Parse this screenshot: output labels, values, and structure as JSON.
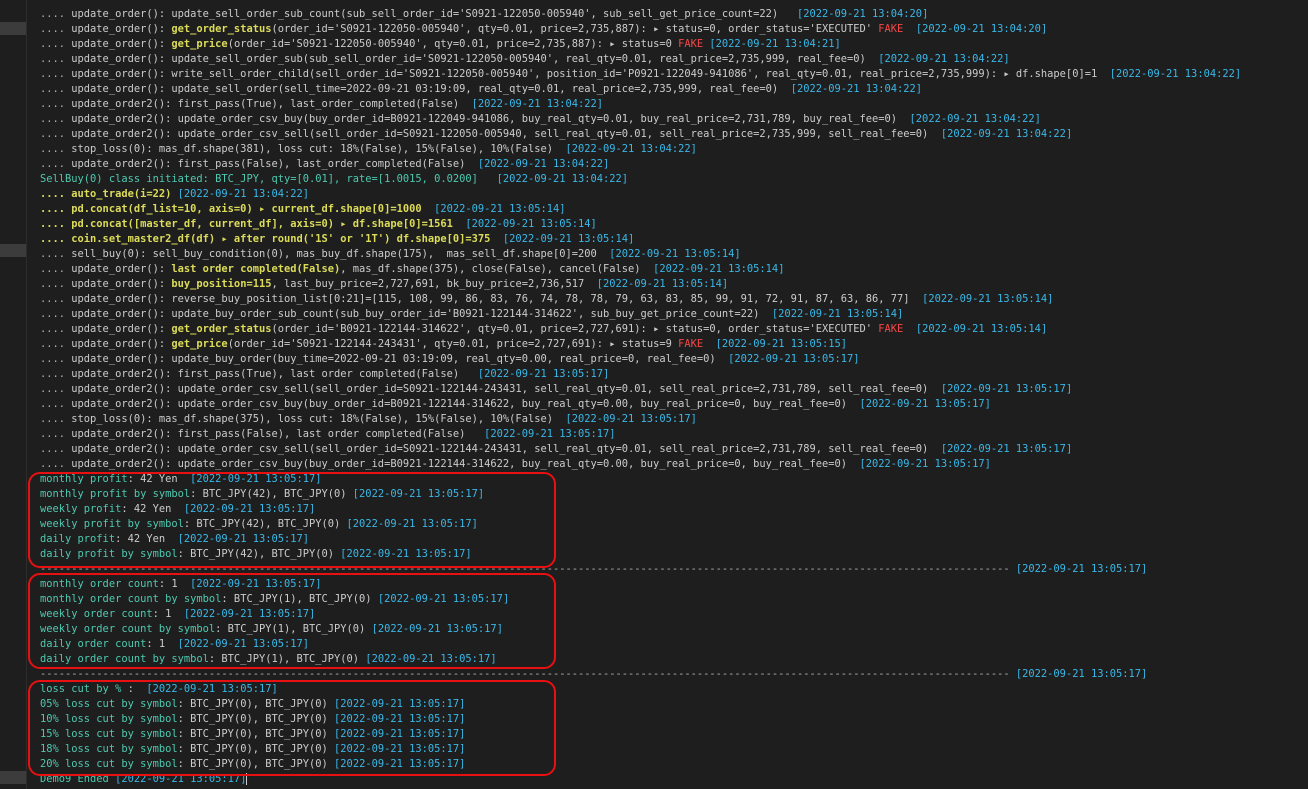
{
  "colors": {
    "background": "#1e1e1e",
    "timestamp": "#3ab8e8",
    "highlight": "#dcdc5a",
    "fake": "#f44747",
    "stat": "#4ec9b0",
    "box": "#e81010"
  },
  "lines": [
    [
      {
        "t": ".... ",
        "c": "d"
      },
      {
        "t": "update_order(): update_sell_order_sub_count(sub_sell_order_id='S0921-122050-005940', sub_sell_get_price_count=22)   ",
        "c": "w"
      },
      {
        "t": "[2022-09-21 13:04:20]",
        "c": "c"
      }
    ],
    [
      {
        "t": ".... ",
        "c": "d"
      },
      {
        "t": "update_order(): ",
        "c": "w"
      },
      {
        "t": "get_order_status",
        "c": "y"
      },
      {
        "t": "(order_id='S0921-122050-005940', qty=0.01, price=2,735,887): ▸ status=0, order_status='EXECUTED' ",
        "c": "w"
      },
      {
        "t": "FAKE",
        "c": "r"
      },
      {
        "t": "  ",
        "c": "w"
      },
      {
        "t": "[2022-09-21 13:04:20]",
        "c": "c"
      }
    ],
    [
      {
        "t": ".... ",
        "c": "d"
      },
      {
        "t": "update_order(): ",
        "c": "w"
      },
      {
        "t": "get_price",
        "c": "y"
      },
      {
        "t": "(order_id='S0921-122050-005940', qty=0.01, price=2,735,887): ▸ status=0 ",
        "c": "w"
      },
      {
        "t": "FAKE",
        "c": "r"
      },
      {
        "t": " ",
        "c": "w"
      },
      {
        "t": "[2022-09-21 13:04:21]",
        "c": "c"
      }
    ],
    [
      {
        "t": ".... ",
        "c": "d"
      },
      {
        "t": "update_order(): update_sell_order_sub(sub_sell_order_id='S0921-122050-005940', real_qty=0.01, real_price=2,735,999, real_fee=0)  ",
        "c": "w"
      },
      {
        "t": "[2022-09-21 13:04:22]",
        "c": "c"
      }
    ],
    [
      {
        "t": ".... ",
        "c": "d"
      },
      {
        "t": "update_order(): write_sell_order_child(sell_order_id='S0921-122050-005940', position_id='P0921-122049-941086', real_qty=0.01, real_price=2,735,999): ▸ df.shape[0]=1  ",
        "c": "w"
      },
      {
        "t": "[2022-09-21 13:04:22]",
        "c": "c"
      }
    ],
    [
      {
        "t": ".... ",
        "c": "d"
      },
      {
        "t": "update_order(): update_sell_order(sell_time=2022-09-21 03:19:09, real_qty=0.01, real_price=2,735,999, real_fee=0)  ",
        "c": "w"
      },
      {
        "t": "[2022-09-21 13:04:22]",
        "c": "c"
      }
    ],
    [
      {
        "t": ".... ",
        "c": "d"
      },
      {
        "t": "update_order2(): first_pass(True), last_order_completed(False)  ",
        "c": "w"
      },
      {
        "t": "[2022-09-21 13:04:22]",
        "c": "c"
      }
    ],
    [
      {
        "t": ".... ",
        "c": "d"
      },
      {
        "t": "update_order2(): update_order_csv_buy(buy_order_id=B0921-122049-941086, buy_real_qty=0.01, buy_real_price=2,731,789, buy_real_fee=0)  ",
        "c": "w"
      },
      {
        "t": "[2022-09-21 13:04:22]",
        "c": "c"
      }
    ],
    [
      {
        "t": ".... ",
        "c": "d"
      },
      {
        "t": "update_order2(): update_order_csv_sell(sell_order_id=S0921-122050-005940, sell_real_qty=0.01, sell_real_price=2,735,999, sell_real_fee=0)  ",
        "c": "w"
      },
      {
        "t": "[2022-09-21 13:04:22]",
        "c": "c"
      }
    ],
    [
      {
        "t": ".... ",
        "c": "d"
      },
      {
        "t": "stop_loss(0): mas_df.shape(381), loss cut: 18%(False), 15%(False), 10%(False)  ",
        "c": "w"
      },
      {
        "t": "[2022-09-21 13:04:22]",
        "c": "c"
      }
    ],
    [
      {
        "t": ".... ",
        "c": "d"
      },
      {
        "t": "update_order2(): first_pass(False), last_order_completed(False)  ",
        "c": "w"
      },
      {
        "t": "[2022-09-21 13:04:22]",
        "c": "c"
      }
    ],
    [
      {
        "t": "SellBuy(0) class initiated: BTC_JPY, qty=[0.01], rate=[1.0015, 0.0200]   ",
        "c": "g"
      },
      {
        "t": "[2022-09-21 13:04:22]",
        "c": "c"
      }
    ],
    [
      {
        "t": ".... auto_trade(i=22) ",
        "c": "y"
      },
      {
        "t": "[2022-09-21 13:04:22]",
        "c": "c"
      }
    ],
    [
      {
        "t": ".... pd.concat(df_list=10, axis=0) ▸ current_df.shape[0]=1000  ",
        "c": "y"
      },
      {
        "t": "[2022-09-21 13:05:14]",
        "c": "c"
      }
    ],
    [
      {
        "t": ".... pd.concat([master_df, current_df], axis=0) ▸ df.shape[0]=1561  ",
        "c": "y"
      },
      {
        "t": "[2022-09-21 13:05:14]",
        "c": "c"
      }
    ],
    [
      {
        "t": ".... coin.set_master2_df(df) ▸ after round('1S' or '1T') df.shape[0]=375  ",
        "c": "y"
      },
      {
        "t": "[2022-09-21 13:05:14]",
        "c": "c"
      }
    ],
    [
      {
        "t": ".... ",
        "c": "d"
      },
      {
        "t": "sell_buy(0): sell_buy_condition(0), mas_buy_df.shape(175),  mas_sell_df.shape[0]=200  ",
        "c": "w"
      },
      {
        "t": "[2022-09-21 13:05:14]",
        "c": "c"
      }
    ],
    [
      {
        "t": ".... ",
        "c": "d"
      },
      {
        "t": "update_order(): ",
        "c": "w"
      },
      {
        "t": "last order completed(False)",
        "c": "y"
      },
      {
        "t": ", mas_df.shape(375), close(False), cancel(False)  ",
        "c": "w"
      },
      {
        "t": "[2022-09-21 13:05:14]",
        "c": "c"
      }
    ],
    [
      {
        "t": ".... ",
        "c": "d"
      },
      {
        "t": "update_order(): ",
        "c": "w"
      },
      {
        "t": "buy_position=115",
        "c": "y"
      },
      {
        "t": ", last_buy_price=2,727,691, bk_buy_price=2,736,517  ",
        "c": "w"
      },
      {
        "t": "[2022-09-21 13:05:14]",
        "c": "c"
      }
    ],
    [
      {
        "t": ".... ",
        "c": "d"
      },
      {
        "t": "update_order(): reverse_buy_position_list[0:21]=[115, 108, 99, 86, 83, 76, 74, 78, 78, 79, 63, 83, 85, 99, 91, 72, 91, 87, 63, 86, 77]  ",
        "c": "w"
      },
      {
        "t": "[2022-09-21 13:05:14]",
        "c": "c"
      }
    ],
    [
      {
        "t": ".... ",
        "c": "d"
      },
      {
        "t": "update_order(): update_buy_order_sub_count(sub_buy_order_id='B0921-122144-314622', sub_buy_get_price_count=22)  ",
        "c": "w"
      },
      {
        "t": "[2022-09-21 13:05:14]",
        "c": "c"
      }
    ],
    [
      {
        "t": ".... ",
        "c": "d"
      },
      {
        "t": "update_order(): ",
        "c": "w"
      },
      {
        "t": "get_order_status",
        "c": "y"
      },
      {
        "t": "(order_id='B0921-122144-314622', qty=0.01, price=2,727,691): ▸ status=0, order_status='EXECUTED' ",
        "c": "w"
      },
      {
        "t": "FAKE",
        "c": "r"
      },
      {
        "t": "  ",
        "c": "w"
      },
      {
        "t": "[2022-09-21 13:05:14]",
        "c": "c"
      }
    ],
    [
      {
        "t": ".... ",
        "c": "d"
      },
      {
        "t": "update_order(): ",
        "c": "w"
      },
      {
        "t": "get_price",
        "c": "y"
      },
      {
        "t": "(order_id='S0921-122144-243431', qty=0.01, price=2,727,691): ▸ status=9 ",
        "c": "w"
      },
      {
        "t": "FAKE",
        "c": "r"
      },
      {
        "t": "  ",
        "c": "w"
      },
      {
        "t": "[2022-09-21 13:05:15]",
        "c": "c"
      }
    ],
    [
      {
        "t": ".... ",
        "c": "d"
      },
      {
        "t": "update_order(): update_buy_order(buy_time=2022-09-21 03:19:09, real_qty=0.00, real_price=0, real_fee=0)  ",
        "c": "w"
      },
      {
        "t": "[2022-09-21 13:05:17]",
        "c": "c"
      }
    ],
    [
      {
        "t": ".... ",
        "c": "d"
      },
      {
        "t": "update_order2(): first_pass(True), last order completed(False)   ",
        "c": "w"
      },
      {
        "t": "[2022-09-21 13:05:17]",
        "c": "c"
      }
    ],
    [
      {
        "t": ".... ",
        "c": "d"
      },
      {
        "t": "update_order2(): update_order_csv_sell(sell_order_id=S0921-122144-243431, sell_real_qty=0.01, sell_real_price=2,731,789, sell_real_fee=0)  ",
        "c": "w"
      },
      {
        "t": "[2022-09-21 13:05:17]",
        "c": "c"
      }
    ],
    [
      {
        "t": ".... ",
        "c": "d"
      },
      {
        "t": "update_order2(): update_order_csv_buy(buy_order_id=B0921-122144-314622, buy_real_qty=0.00, buy_real_price=0, buy_real_fee=0)  ",
        "c": "w"
      },
      {
        "t": "[2022-09-21 13:05:17]",
        "c": "c"
      }
    ],
    [
      {
        "t": ".... ",
        "c": "d"
      },
      {
        "t": "stop_loss(0): mas_df.shape(375), loss cut: 18%(False), 15%(False), 10%(False)  ",
        "c": "w"
      },
      {
        "t": "[2022-09-21 13:05:17]",
        "c": "c"
      }
    ],
    [
      {
        "t": ".... ",
        "c": "d"
      },
      {
        "t": "update_order2(): first_pass(False), last order completed(False)   ",
        "c": "w"
      },
      {
        "t": "[2022-09-21 13:05:17]",
        "c": "c"
      }
    ],
    [
      {
        "t": ".... ",
        "c": "d"
      },
      {
        "t": "update_order2(): update_order_csv_sell(sell_order_id=S0921-122144-243431, sell_real_qty=0.01, sell_real_price=2,731,789, sell_real_fee=0)  ",
        "c": "w"
      },
      {
        "t": "[2022-09-21 13:05:17]",
        "c": "c"
      }
    ],
    [
      {
        "t": ".... ",
        "c": "d"
      },
      {
        "t": "update_order2(): update_order_csv_buy(buy_order_id=B0921-122144-314622, buy_real_qty=0.00, buy_real_price=0, buy_real_fee=0)  ",
        "c": "w"
      },
      {
        "t": "[2022-09-21 13:05:17]",
        "c": "c"
      }
    ],
    [
      {
        "t": "monthly profit",
        "c": "g"
      },
      {
        "t": ": 42 Yen  ",
        "c": "w"
      },
      {
        "t": "[2022-09-21 13:05:17]",
        "c": "c"
      }
    ],
    [
      {
        "t": "monthly profit by symbol",
        "c": "g"
      },
      {
        "t": ": BTC_JPY(42), BTC_JPY(0) ",
        "c": "w"
      },
      {
        "t": "[2022-09-21 13:05:17]",
        "c": "c"
      }
    ],
    [
      {
        "t": "weekly profit",
        "c": "g"
      },
      {
        "t": ": 42 Yen  ",
        "c": "w"
      },
      {
        "t": "[2022-09-21 13:05:17]",
        "c": "c"
      }
    ],
    [
      {
        "t": "weekly profit by symbol",
        "c": "g"
      },
      {
        "t": ": BTC_JPY(42), BTC_JPY(0) ",
        "c": "w"
      },
      {
        "t": "[2022-09-21 13:05:17]",
        "c": "c"
      }
    ],
    [
      {
        "t": "daily profit",
        "c": "g"
      },
      {
        "t": ": 42 Yen  ",
        "c": "w"
      },
      {
        "t": "[2022-09-21 13:05:17]",
        "c": "c"
      }
    ],
    [
      {
        "t": "daily profit by symbol",
        "c": "g"
      },
      {
        "t": ": BTC_JPY(42), BTC_JPY(0) ",
        "c": "w"
      },
      {
        "t": "[2022-09-21 13:05:17]",
        "c": "c"
      }
    ],
    [
      {
        "t": "----------------------------------------------------------------------------------------------------------------------------------------------------------- ",
        "c": "d"
      },
      {
        "t": "[2022-09-21 13:05:17]",
        "c": "c"
      }
    ],
    [
      {
        "t": "monthly order count",
        "c": "g"
      },
      {
        "t": ": 1  ",
        "c": "w"
      },
      {
        "t": "[2022-09-21 13:05:17]",
        "c": "c"
      }
    ],
    [
      {
        "t": "monthly order count by symbol",
        "c": "g"
      },
      {
        "t": ": BTC_JPY(1), BTC_JPY(0) ",
        "c": "w"
      },
      {
        "t": "[2022-09-21 13:05:17]",
        "c": "c"
      }
    ],
    [
      {
        "t": "weekly order count",
        "c": "g"
      },
      {
        "t": ": 1  ",
        "c": "w"
      },
      {
        "t": "[2022-09-21 13:05:17]",
        "c": "c"
      }
    ],
    [
      {
        "t": "weekly order count by symbol",
        "c": "g"
      },
      {
        "t": ": BTC_JPY(1), BTC_JPY(0) ",
        "c": "w"
      },
      {
        "t": "[2022-09-21 13:05:17]",
        "c": "c"
      }
    ],
    [
      {
        "t": "daily order count",
        "c": "g"
      },
      {
        "t": ": 1  ",
        "c": "w"
      },
      {
        "t": "[2022-09-21 13:05:17]",
        "c": "c"
      }
    ],
    [
      {
        "t": "daily order count by symbol",
        "c": "g"
      },
      {
        "t": ": BTC_JPY(1), BTC_JPY(0) ",
        "c": "w"
      },
      {
        "t": "[2022-09-21 13:05:17]",
        "c": "c"
      }
    ],
    [
      {
        "t": "----------------------------------------------------------------------------------------------------------------------------------------------------------- ",
        "c": "d"
      },
      {
        "t": "[2022-09-21 13:05:17]",
        "c": "c"
      }
    ],
    [
      {
        "t": "loss cut by %",
        "c": "g"
      },
      {
        "t": " :  ",
        "c": "w"
      },
      {
        "t": "[2022-09-21 13:05:17]",
        "c": "c"
      }
    ],
    [
      {
        "t": "05% loss cut by symbol",
        "c": "g"
      },
      {
        "t": ": BTC_JPY(0), BTC_JPY(0) ",
        "c": "w"
      },
      {
        "t": "[2022-09-21 13:05:17]",
        "c": "c"
      }
    ],
    [
      {
        "t": "10% loss cut by symbol",
        "c": "g"
      },
      {
        "t": ": BTC_JPY(0), BTC_JPY(0) ",
        "c": "w"
      },
      {
        "t": "[2022-09-21 13:05:17]",
        "c": "c"
      }
    ],
    [
      {
        "t": "15% loss cut by symbol",
        "c": "g"
      },
      {
        "t": ": BTC_JPY(0), BTC_JPY(0) ",
        "c": "w"
      },
      {
        "t": "[2022-09-21 13:05:17]",
        "c": "c"
      }
    ],
    [
      {
        "t": "18% loss cut by symbol",
        "c": "g"
      },
      {
        "t": ": BTC_JPY(0), BTC_JPY(0) ",
        "c": "w"
      },
      {
        "t": "[2022-09-21 13:05:17]",
        "c": "c"
      }
    ],
    [
      {
        "t": "20% loss cut by symbol",
        "c": "g"
      },
      {
        "t": ": BTC_JPY(0), BTC_JPY(0) ",
        "c": "w"
      },
      {
        "t": "[2022-09-21 13:05:17]",
        "c": "c"
      }
    ],
    [
      {
        "t": "Demo9 Ended ",
        "c": "g"
      },
      {
        "t": "[2022-09-21 13:05:17]",
        "c": "c"
      }
    ]
  ]
}
